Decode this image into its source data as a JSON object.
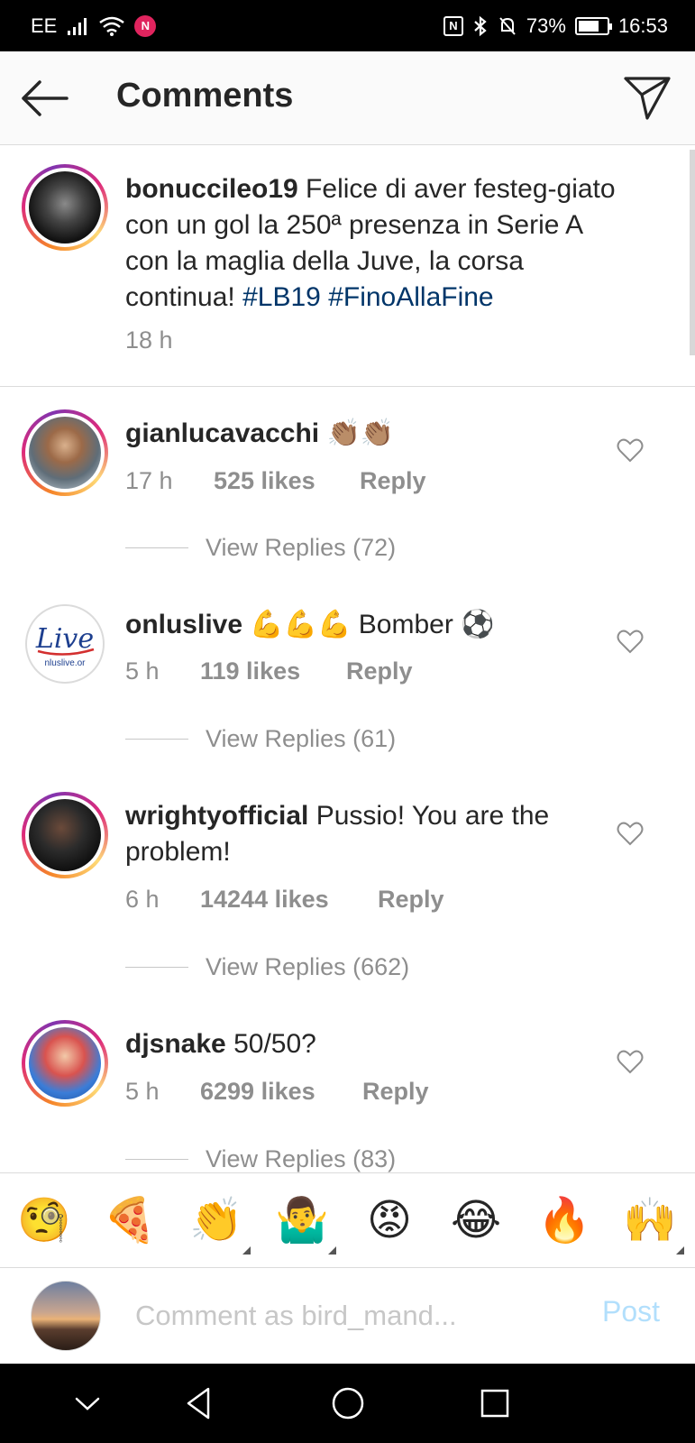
{
  "status_bar": {
    "carrier": "EE",
    "nfc_badge": "N",
    "nfc_box": "N",
    "battery_percent": "73%",
    "battery_level": 0.73,
    "time": "16:53"
  },
  "header": {
    "title": "Comments"
  },
  "caption": {
    "username": "bonuccileo19",
    "text_before": " Felice di aver festeg-giato con un gol la 250ª presenza in Serie A con la maglia della Juve, la corsa continua! ",
    "hashtag1": "#LB19",
    "hashtag2": "#FinoAllaFine",
    "time": "18 h"
  },
  "comments": [
    {
      "username": "gianlucavacchi",
      "text": " 👏🏽👏🏽",
      "time": "17 h",
      "likes": "525 likes",
      "reply": "Reply",
      "view_replies": "View Replies (72)"
    },
    {
      "username": "onluslive",
      "text": " 💪💪💪 Bomber ⚽",
      "time": "5 h",
      "likes": "119 likes",
      "reply": "Reply",
      "view_replies": "View Replies (61)",
      "avatar_logo": "Live",
      "avatar_sub": "nluslive.or"
    },
    {
      "username": "wrightyofficial",
      "text": " Pussio! You are the problem!",
      "time": "6 h",
      "likes": "14244 likes",
      "reply": "Reply",
      "view_replies": "View Replies (662)"
    },
    {
      "username": "djsnake",
      "text": " 50/50?",
      "time": "5 h",
      "likes": "6299 likes",
      "reply": "Reply",
      "view_replies": "View Replies (83)"
    }
  ],
  "emoji_bar": [
    "🧐",
    "🍕",
    "👏",
    "🤷‍♂️",
    "😡",
    "😂",
    "🔥",
    "🙌"
  ],
  "composer": {
    "placeholder": "Comment as bird_mand...",
    "post_label": "Post"
  },
  "colors": {
    "hashtag": "#003569",
    "post_disabled": "#b2dffc",
    "secondary_text": "#8e8e8e"
  }
}
